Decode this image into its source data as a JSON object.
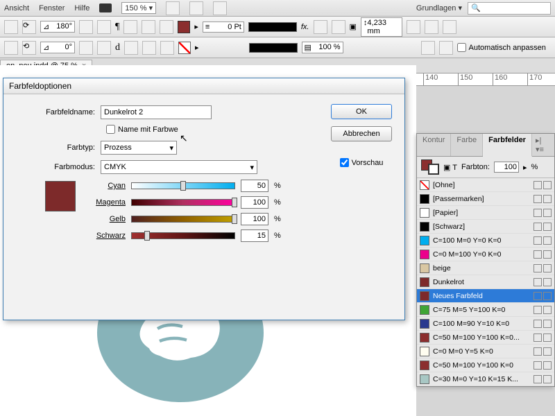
{
  "menu": {
    "ansicht": "Ansicht",
    "fenster": "Fenster",
    "hilfe": "Hilfe",
    "br": "Br",
    "zoom": "150 %",
    "grundlagen": "Grundlagen",
    "search_placeholder": ""
  },
  "toolbar": {
    "angle1": "180°",
    "angle2": "0°",
    "stroke_pt": "0 Pt",
    "scale": "100 %",
    "size_mm": "4,233 mm",
    "autofit": "Automatisch anpassen"
  },
  "doc_tab": {
    "name": "en_neu.indd @ 75 %"
  },
  "ruler": {
    "ticks": [
      140,
      150,
      160,
      170
    ]
  },
  "dialog": {
    "title": "Farbfeldoptionen",
    "name_label": "Farbfeldname:",
    "name_value": "Dunkelrot 2",
    "name_with_value": "Name mit Farbwe",
    "type_label": "Farbtyp:",
    "type_value": "Prozess",
    "mode_label": "Farbmodus:",
    "mode_value": "CMYK",
    "ok": "OK",
    "cancel": "Abbrechen",
    "preview": "Vorschau",
    "cmyk": {
      "cyan": {
        "label": "Cyan",
        "value": "50"
      },
      "magenta": {
        "label": "Magenta",
        "value": "100"
      },
      "gelb": {
        "label": "Gelb",
        "value": "100"
      },
      "schwarz": {
        "label": "Schwarz",
        "value": "15"
      }
    },
    "pct": "%"
  },
  "panel": {
    "tabs": {
      "kontur": "Kontur",
      "farbe": "Farbe",
      "farbfelder": "Farbfelder"
    },
    "farbton_label": "Farbton:",
    "farbton_value": "100",
    "pct": "%",
    "swatches": [
      {
        "name": "[Ohne]",
        "chip": "none"
      },
      {
        "name": "[Passermarken]",
        "chip": "#000000"
      },
      {
        "name": "[Papier]",
        "chip": "#ffffff"
      },
      {
        "name": "[Schwarz]",
        "chip": "#000000"
      },
      {
        "name": "C=100 M=0 Y=0 K=0",
        "chip": "#00aeef"
      },
      {
        "name": "C=0 M=100 Y=0 K=0",
        "chip": "#ec008c"
      },
      {
        "name": "beige",
        "chip": "#d9c7a3"
      },
      {
        "name": "Dunkelrot",
        "chip": "#7d2a2a"
      },
      {
        "name": "Neues Farbfeld",
        "chip": "#7d2a2a",
        "selected": true
      },
      {
        "name": "C=75 M=5 Y=100 K=0",
        "chip": "#3fa535"
      },
      {
        "name": "C=100 M=90 Y=10 K=0",
        "chip": "#2a3a8f"
      },
      {
        "name": "C=50 M=100 Y=100 K=0...",
        "chip": "#8b2e2e"
      },
      {
        "name": "C=0 M=0 Y=5 K=0",
        "chip": "#fffdf0"
      },
      {
        "name": "C=50 M=100 Y=100 K=0",
        "chip": "#8b2e2e"
      },
      {
        "name": "C=30 M=0 Y=10 K=15 K...",
        "chip": "#a8c7c4"
      }
    ]
  }
}
